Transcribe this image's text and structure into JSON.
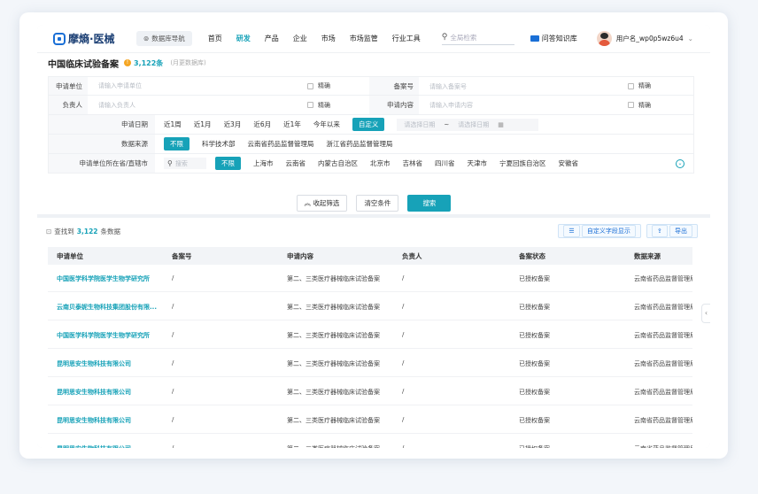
{
  "header": {
    "logo": "摩熵·医械",
    "nav_guide": "数据库导航",
    "nav": [
      "首页",
      "研发",
      "产品",
      "企业",
      "市场",
      "市场监管",
      "行业工具"
    ],
    "active_nav": 1,
    "search_placeholder": "全局检索",
    "qa_label": "问答知识库",
    "username": "用户名_wp0p5wz6u4"
  },
  "page": {
    "title": "中国临床试验备案",
    "count": "3,122条",
    "subtitle": "(月更数据库)"
  },
  "filters": {
    "row1": {
      "label_a": "申请单位",
      "ph_a": "请输入申请单位",
      "label_b": "备案号",
      "ph_b": "请输入备案号",
      "exact": "精确"
    },
    "row2": {
      "label_a": "负责人",
      "ph_a": "请输入负责人",
      "label_b": "申请内容",
      "ph_b": "请输入申请内容",
      "exact": "精确"
    },
    "date": {
      "label": "申请日期",
      "options": [
        "近1周",
        "近1月",
        "近3月",
        "近6月",
        "近1年",
        "今年以来",
        "自定义"
      ],
      "start_ph": "请选择日期",
      "sep": "~",
      "end_ph": "请选择日期"
    },
    "source": {
      "label": "数据来源",
      "options": [
        "不限",
        "科学技术部",
        "云南省药品监督管理局",
        "浙江省药品监督管理局"
      ]
    },
    "region": {
      "label": "申请单位所在省/直辖市",
      "search_ph": "搜索",
      "options": [
        "不限",
        "上海市",
        "云南省",
        "内蒙古自治区",
        "北京市",
        "吉林省",
        "四川省",
        "天津市",
        "宁夏回族自治区",
        "安徽省"
      ]
    },
    "buttons": {
      "collapse": "收起筛选",
      "clear": "清空条件",
      "search": "搜索"
    }
  },
  "results": {
    "found_prefix": "查找到",
    "found_count": "3,122",
    "found_suffix": "条数据",
    "custom_fields": "自定义字段显示",
    "export": "导出",
    "columns": [
      "申请单位",
      "备案号",
      "申请内容",
      "负责人",
      "备案状态",
      "数据来源"
    ],
    "rows": [
      [
        "中国医学科学院医学生物学研究所",
        "/",
        "第二、三类医疗器械临床试验备案",
        "/",
        "已授权备案",
        "云南省药品监督管理局"
      ],
      [
        "云南贝泰妮生物科技集团股份有限...",
        "/",
        "第二、三类医疗器械临床试验备案",
        "/",
        "已授权备案",
        "云南省药品监督管理局"
      ],
      [
        "中国医学科学院医学生物学研究所",
        "/",
        "第二、三类医疗器械临床试验备案",
        "/",
        "已授权备案",
        "云南省药品监督管理局"
      ],
      [
        "昆明思安生物科技有限公司",
        "/",
        "第二、三类医疗器械临床试验备案",
        "/",
        "已授权备案",
        "云南省药品监督管理局"
      ],
      [
        "昆明思安生物科技有限公司",
        "/",
        "第二、三类医疗器械临床试验备案",
        "/",
        "已授权备案",
        "云南省药品监督管理局"
      ],
      [
        "昆明思安生物科技有限公司",
        "/",
        "第二、三类医疗器械临床试验备案",
        "/",
        "已授权备案",
        "云南省药品监督管理局"
      ],
      [
        "昆明思安生物科技有限公司",
        "/",
        "第二、三类医疗器械临床试验备案",
        "/",
        "已授权备案",
        "云南省药品监督管理局"
      ]
    ]
  },
  "colors": {
    "accent": "#17a2b8",
    "brand": "#1a6fd6"
  }
}
